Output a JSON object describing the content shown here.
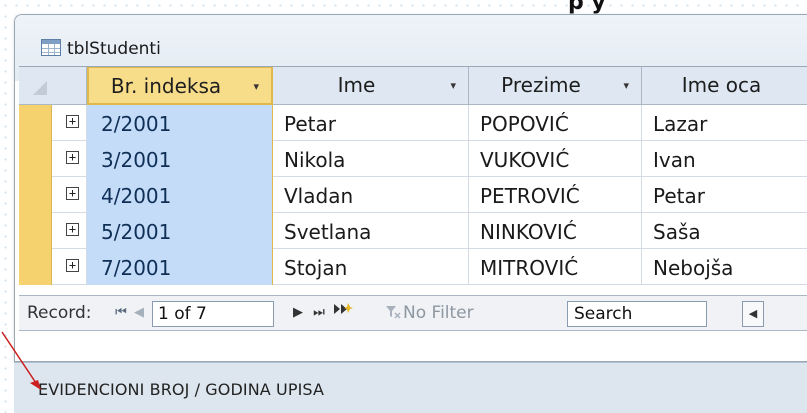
{
  "top_fragment": "p y",
  "window": {
    "title": "tblStudenti"
  },
  "columns": [
    {
      "label": "Br. indeksa",
      "arrow": "▾",
      "selected": true
    },
    {
      "label": "Ime",
      "arrow": "▾"
    },
    {
      "label": "Prezime",
      "arrow": "▾"
    },
    {
      "label": "Ime oca",
      "arrow": "▾"
    }
  ],
  "rows": [
    {
      "expander": "+",
      "index": "2/2001",
      "ime": "Petar",
      "prezime": "POPOVIĆ",
      "ime_oca": "Lazar"
    },
    {
      "expander": "+",
      "index": "3/2001",
      "ime": "Nikola",
      "prezime": "VUKOVIĆ",
      "ime_oca": "Ivan"
    },
    {
      "expander": "+",
      "index": "4/2001",
      "ime": "Vladan",
      "prezime": "PETROVIĆ",
      "ime_oca": "Petar"
    },
    {
      "expander": "+",
      "index": "5/2001",
      "ime": "Svetlana",
      "prezime": "NINKOVIĆ",
      "ime_oca": "Saša"
    },
    {
      "expander": "+",
      "index": "7/2001",
      "ime": "Stojan",
      "prezime": "MITROVIĆ",
      "ime_oca": "Nebojša"
    }
  ],
  "navigation": {
    "label": "Record:",
    "first_icon": "⏮",
    "prev_icon": "◀",
    "position": "1 of 7",
    "next_icon": "▶",
    "last_icon": "⏭",
    "new_icon": "new-record-icon",
    "filter_label": "No Filter",
    "search_label": "Search",
    "scroll_icon": "◀"
  },
  "status": {
    "text": "EVIDENCIONI BROJ / GODINA UPISA"
  },
  "colors": {
    "selected_header": "#f7dd8a",
    "selected_column": "#c4dcf8",
    "row_selector": "#f6d26f",
    "annotation_arrow": "#cc1f1f"
  }
}
